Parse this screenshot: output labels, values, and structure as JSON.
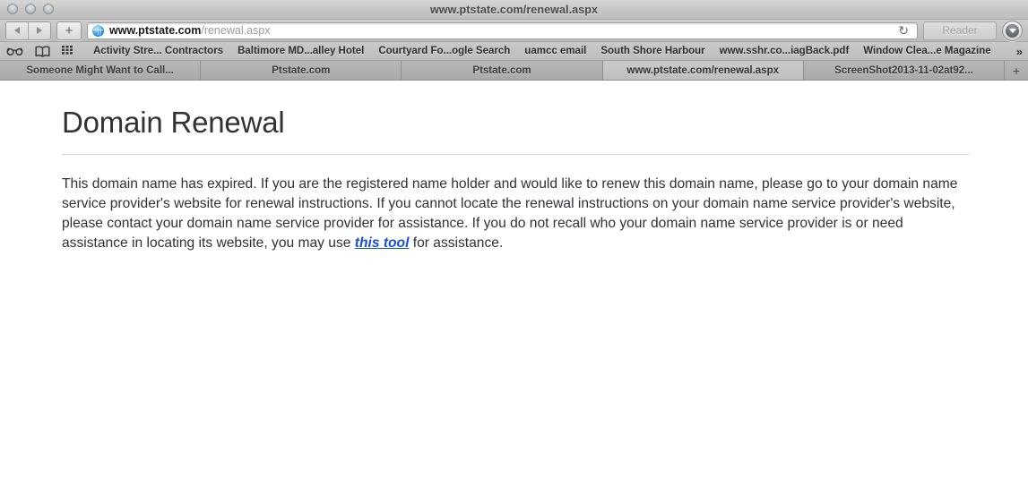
{
  "window": {
    "title": "www.ptstate.com/renewal.aspx",
    "traffic_lights": [
      "close",
      "minimize",
      "zoom"
    ]
  },
  "toolbar": {
    "back_label": "Back",
    "forward_label": "Forward",
    "new_tab_label": "+",
    "address": {
      "domain": "www.ptstate.com",
      "path": "/renewal.aspx",
      "favicon": "globe-icon",
      "reload_icon": "↻"
    },
    "reader_label": "Reader",
    "downloads_label": "Downloads"
  },
  "bookmarks": {
    "icons": [
      "reading-list-icon",
      "bookmarks-book-icon",
      "top-sites-grid-icon"
    ],
    "items": [
      {
        "label": "Activity Stre... Contractors"
      },
      {
        "label": "Baltimore MD...alley Hotel"
      },
      {
        "label": "Courtyard Fo...ogle Search"
      },
      {
        "label": "uamcc email"
      },
      {
        "label": "South Shore Harbour"
      },
      {
        "label": "www.sshr.co...iagBack.pdf"
      },
      {
        "label": "Window Clea...e Magazine"
      }
    ],
    "overflow_label": "»"
  },
  "tabs": {
    "items": [
      {
        "label": "Someone Might Want to Call...",
        "active": false
      },
      {
        "label": "Ptstate.com",
        "active": false
      },
      {
        "label": "Ptstate.com",
        "active": false
      },
      {
        "label": "www.ptstate.com/renewal.aspx",
        "active": true
      },
      {
        "label": "ScreenShot2013-11-02at92...",
        "active": false
      }
    ],
    "add_tab_label": "+"
  },
  "page": {
    "heading": "Domain Renewal",
    "paragraph_part1": "This domain name has expired. If you are the registered name holder and would like to renew this domain name, please go to your domain name service provider's website for renewal instructions. If you cannot locate the renewal instructions on your domain name service provider's website, please contact your domain name service provider for assistance. If you do not recall who your domain name service provider is or need assistance in locating its website, you may use ",
    "link_text": "this tool",
    "paragraph_part2": " for assistance."
  },
  "colors": {
    "link": "#1a4fd6",
    "chrome": "#bdbdbd",
    "text": "#2e3235"
  }
}
